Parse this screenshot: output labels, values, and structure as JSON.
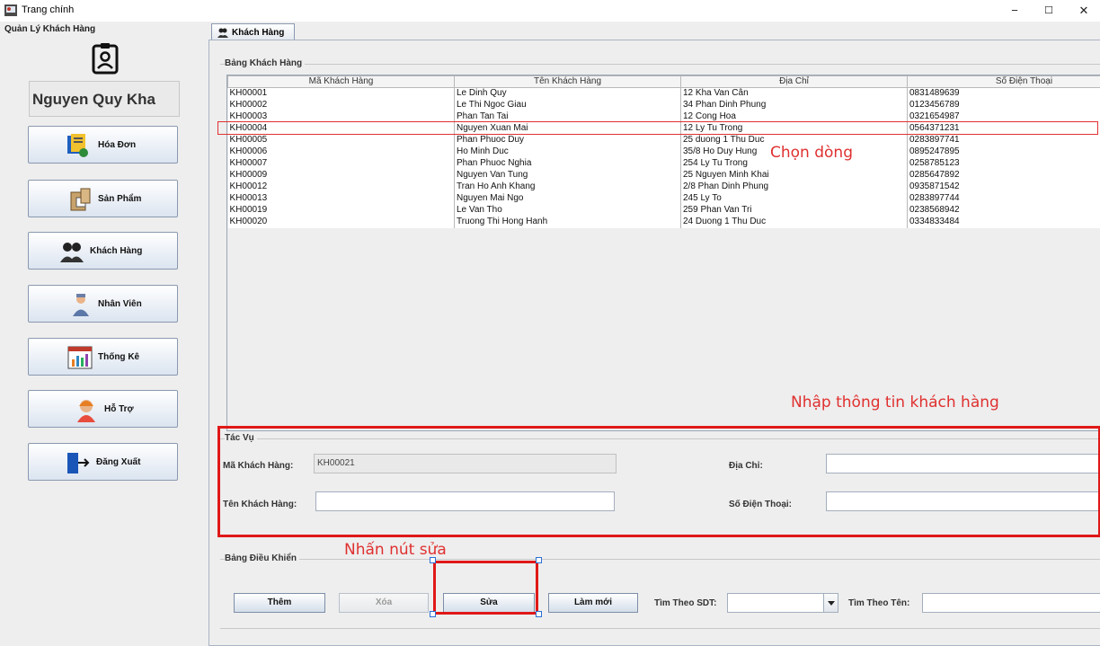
{
  "window": {
    "title": "Trang chính",
    "minimize": "−",
    "maximize": "☐",
    "close": "✕"
  },
  "sidebar": {
    "title": "Quản Lý Khách Hàng",
    "user_name": "Nguyen Quy Kha",
    "items": [
      {
        "label": "Hóa Đơn",
        "icon": "invoice-icon"
      },
      {
        "label": "Sản Phẩm",
        "icon": "product-icon"
      },
      {
        "label": "Khách Hàng",
        "icon": "customers-icon"
      },
      {
        "label": "Nhân Viên",
        "icon": "employee-icon"
      },
      {
        "label": "Thống Kê",
        "icon": "statistics-icon"
      },
      {
        "label": "Hỗ Trợ",
        "icon": "support-icon"
      },
      {
        "label": "Đăng Xuất",
        "icon": "logout-icon"
      }
    ]
  },
  "tab": {
    "label": "Khách Hàng"
  },
  "table": {
    "group_title": "Bảng Khách Hàng",
    "columns": [
      "Mã Khách Hàng",
      "Tên Khách Hàng",
      "Địa Chỉ",
      "Số Điện Thoại"
    ],
    "rows": [
      [
        "KH00001",
        "Le Dinh Quy",
        "12 Kha Van Cân",
        "0831489639"
      ],
      [
        "KH00002",
        "Le Thi Ngoc Giau",
        "34 Phan Dinh Phung",
        "0123456789"
      ],
      [
        "KH00003",
        "Phan Tan Tai",
        "12 Cong Hoa",
        "0321654987"
      ],
      [
        "KH00004",
        "Nguyen Xuan Mai",
        "12 Ly Tu Trong",
        "0564371231"
      ],
      [
        "KH00005",
        "Phan Phuoc Duy",
        "25 duong 1 Thu Duc",
        "0283897741"
      ],
      [
        "KH00006",
        "Ho Minh Duc",
        "35/8 Ho Duy Hung",
        "0895247895"
      ],
      [
        "KH00007",
        "Phan Phuoc Nghia",
        "254 Ly Tu Trong",
        "0258785123"
      ],
      [
        "KH00009",
        "Nguyen Van Tung",
        "25 Nguyen Minh Khai",
        "0285647892"
      ],
      [
        "KH00012",
        "Tran Ho Anh Khang",
        "2/8 Phan Dinh Phung",
        "0935871542"
      ],
      [
        "KH00013",
        "Nguyen Mai Ngo",
        "245 Ly To",
        "0283897744"
      ],
      [
        "KH00019",
        "Le Van Tho",
        "259 Phan Van Tri",
        "0238568942"
      ],
      [
        "KH00020",
        "Truong Thi Hong Hanh",
        "24 Duong 1 Thu Duc",
        "0334833484"
      ]
    ]
  },
  "annotations": {
    "select_row": "Chọn dòng",
    "enter_info": "Nhập thông tin khách hàng",
    "click_edit": "Nhấn nút sửa"
  },
  "form": {
    "group_title": "Tác Vụ",
    "customer_id_label": "Mã Khách Hàng:",
    "customer_id_value": "KH00021",
    "customer_name_label": "Tên Khách Hàng:",
    "customer_name_value": "",
    "address_label": "Địa Chỉ:",
    "address_value": "",
    "phone_label": "Số Điện Thoại:",
    "phone_value": ""
  },
  "controls": {
    "group_title": "Bảng Điều Khiển",
    "add_label": "Thêm",
    "delete_label": "Xóa",
    "edit_label": "Sửa",
    "refresh_label": "Làm mới",
    "search_phone_label": "Tìm Theo SDT:",
    "search_name_label": "Tìm Theo Tên:"
  },
  "colors": {
    "annotation": "#e03030",
    "button_gradient_bottom": "#d4deea"
  }
}
